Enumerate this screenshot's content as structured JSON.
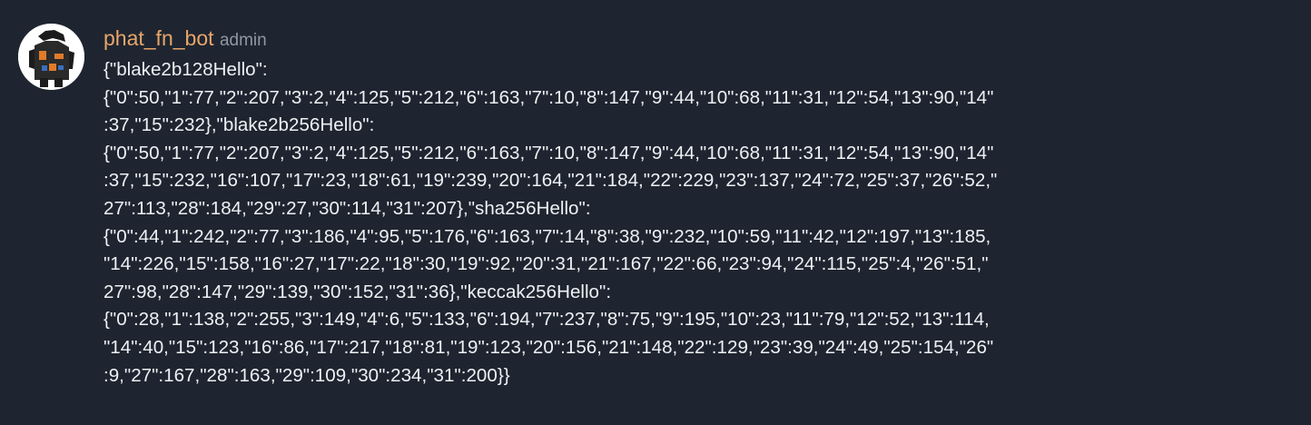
{
  "message": {
    "author": {
      "username": "phat_fn_bot",
      "role": "admin",
      "avatar_icon": "bot-avatar-icon",
      "username_color": "#e8a56a",
      "role_color": "#8f98a5"
    },
    "text_lines": [
      "{\"blake2b128Hello\":",
      "{\"0\":50,\"1\":77,\"2\":207,\"3\":2,\"4\":125,\"5\":212,\"6\":163,\"7\":10,\"8\":147,\"9\":44,\"10\":68,\"11\":31,\"12\":54,\"13\":90,\"14\"",
      ":37,\"15\":232},\"blake2b256Hello\":",
      "{\"0\":50,\"1\":77,\"2\":207,\"3\":2,\"4\":125,\"5\":212,\"6\":163,\"7\":10,\"8\":147,\"9\":44,\"10\":68,\"11\":31,\"12\":54,\"13\":90,\"14\"",
      ":37,\"15\":232,\"16\":107,\"17\":23,\"18\":61,\"19\":239,\"20\":164,\"21\":184,\"22\":229,\"23\":137,\"24\":72,\"25\":37,\"26\":52,\"",
      "27\":113,\"28\":184,\"29\":27,\"30\":114,\"31\":207},\"sha256Hello\":",
      "{\"0\":44,\"1\":242,\"2\":77,\"3\":186,\"4\":95,\"5\":176,\"6\":163,\"7\":14,\"8\":38,\"9\":232,\"10\":59,\"11\":42,\"12\":197,\"13\":185,",
      "\"14\":226,\"15\":158,\"16\":27,\"17\":22,\"18\":30,\"19\":92,\"20\":31,\"21\":167,\"22\":66,\"23\":94,\"24\":115,\"25\":4,\"26\":51,\"",
      "27\":98,\"28\":147,\"29\":139,\"30\":152,\"31\":36},\"keccak256Hello\":",
      "{\"0\":28,\"1\":138,\"2\":255,\"3\":149,\"4\":6,\"5\":133,\"6\":194,\"7\":237,\"8\":75,\"9\":195,\"10\":23,\"11\":79,\"12\":52,\"13\":114,",
      "\"14\":40,\"15\":123,\"16\":86,\"17\":217,\"18\":81,\"19\":123,\"20\":156,\"21\":148,\"22\":129,\"23\":39,\"24\":49,\"25\":154,\"26\"",
      ":9,\"27\":167,\"28\":163,\"29\":109,\"30\":234,\"31\":200}}"
    ]
  }
}
